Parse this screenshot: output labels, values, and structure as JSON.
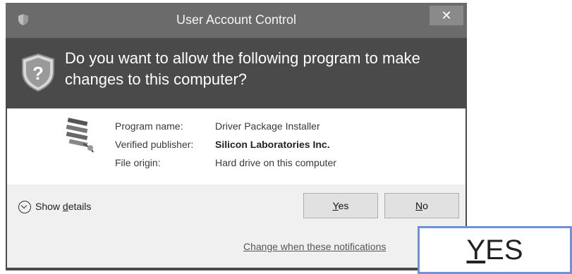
{
  "window": {
    "title": "User Account Control",
    "close_label": "✕"
  },
  "header": {
    "question": "Do you want to allow the following program to make changes to this computer?"
  },
  "details": [
    {
      "label": "Program name:",
      "value": "Driver Package Installer",
      "bold": false
    },
    {
      "label": "Verified publisher:",
      "value": "Silicon Laboratories Inc.",
      "bold": true
    },
    {
      "label": "File origin:",
      "value": "Hard drive on this computer",
      "bold": false
    }
  ],
  "footer": {
    "show_details_prefix": "Show ",
    "show_details_underlined": "d",
    "show_details_rest": "etails",
    "yes_underlined": "Y",
    "yes_rest": "es",
    "no_underlined": "N",
    "no_rest": "o",
    "change_link": "Change when these notifications"
  },
  "callout": {
    "underlined": "Y",
    "rest": "ES"
  },
  "colors": {
    "titlebar": "#6b6b6b",
    "header": "#4a4a4a",
    "footer": "#f0f0f0",
    "callout_border": "#6b93d6"
  },
  "icons": [
    "shield-icon",
    "close-icon",
    "uac-shield-icon",
    "program-icon",
    "chevron-down-icon"
  ]
}
